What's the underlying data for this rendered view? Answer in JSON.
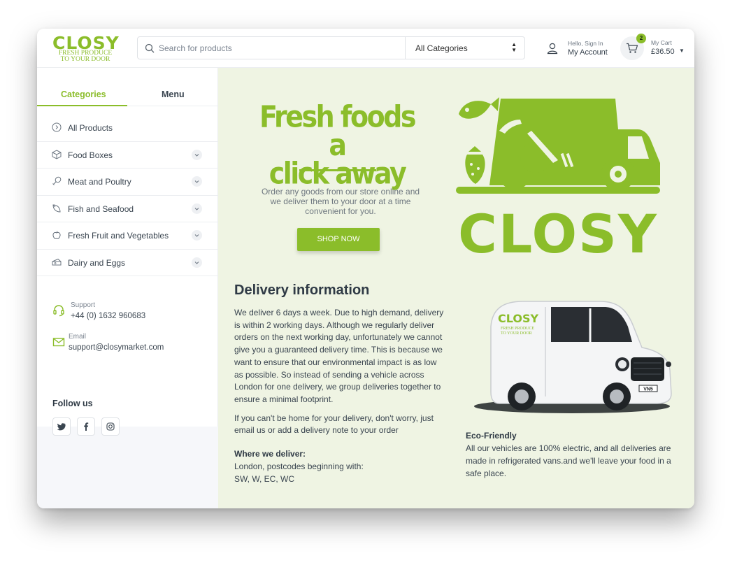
{
  "brand": {
    "name": "CLOSY",
    "tagline_line1": "FRESH PRODUCE",
    "tagline_line2": "TO YOUR DOOR",
    "accent_color": "#8bbd2a"
  },
  "search": {
    "placeholder": "Search for products",
    "category_selected": "All Categories"
  },
  "account": {
    "greeting": "Hello, Sign In",
    "label": "My Account",
    "icon": "user-icon"
  },
  "cart": {
    "count": "2",
    "label": "My Cart",
    "total": "£36.50",
    "icon": "cart-icon"
  },
  "sidebar": {
    "tabs": [
      {
        "label": "Categories",
        "active": true
      },
      {
        "label": "Menu",
        "active": false
      }
    ],
    "categories": [
      {
        "label": "All Products",
        "icon": "circle-arrow-icon"
      },
      {
        "label": "Food Boxes",
        "icon": "box-icon"
      },
      {
        "label": "Meat and Poultry",
        "icon": "drumstick-icon"
      },
      {
        "label": "Fish and Seafood",
        "icon": "fish-icon"
      },
      {
        "label": "Fresh Fruit and Vegetables",
        "icon": "apple-icon"
      },
      {
        "label": "Dairy and Eggs",
        "icon": "cheese-icon"
      }
    ],
    "support": {
      "label": "Support",
      "phone": "+44 (0) 1632 960683"
    },
    "email": {
      "label": "Email",
      "address": "support@closymarket.com"
    },
    "follow_title": "Follow us",
    "socials": [
      "twitter-icon",
      "facebook-icon",
      "instagram-icon"
    ]
  },
  "hero": {
    "title_line1": "Fresh foods a",
    "title_line2": "click away",
    "text": "Order any goods from our store online and we deliver them to your door at a time convenient for you.",
    "button": "SHOP NOW",
    "logo_word": "CLOSY"
  },
  "delivery": {
    "title": "Delivery information",
    "para1": "We deliver 6 days a week. Due to high demand, delivery is within 2 working days. Although we regularly deliver orders on the next working day, unfortunately we cannot give you a guaranteed delivery time. This is because we want to ensure that our environmental impact is as low as possible. So instead of sending a vehicle across London for one delivery, we group deliveries together to ensure a minimal footprint.",
    "para2": "If you can't be home for your delivery, don't worry, just email us or add a delivery note to your order",
    "where_title": "Where we deliver:",
    "where_line1": "London, postcodes beginning with:",
    "where_line2": "SW, W, EC, WC"
  },
  "van": {
    "brand": "CLOSY",
    "tagline_line1": "FRESH PRODUCE",
    "tagline_line2": "TO YOUR DOOR",
    "plate": "VN5"
  },
  "eco": {
    "title": "Eco-Friendly",
    "text": "All our vehicles are 100% electric, and all deliveries are made in refrigerated vans.and we'll leave your food in a safe place."
  }
}
